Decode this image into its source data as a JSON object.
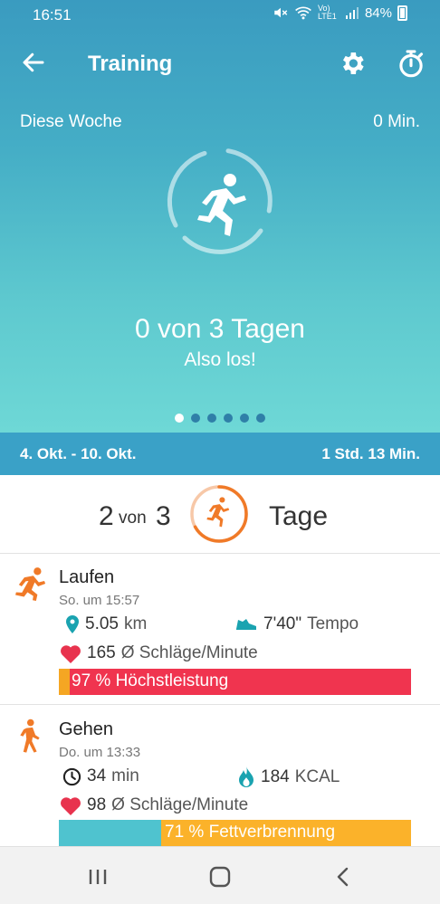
{
  "status_bar": {
    "time": "16:51",
    "network": "Vo) LTE1",
    "battery": "84%"
  },
  "app_bar": {
    "title": "Training"
  },
  "hero": {
    "week_label": "Diese Woche",
    "week_minutes": "0 Min.",
    "days_text": "0 von 3 Tagen",
    "cheer_text": "Also los!",
    "page_count": 6,
    "active_page": 0
  },
  "range": {
    "dates": "4. Okt. - 10. Okt.",
    "total": "1 Std. 13 Min."
  },
  "summary": {
    "done": "2",
    "von": "von",
    "goal": "3",
    "unit": "Tage",
    "progress": 0.67
  },
  "activities": [
    {
      "name": "Laufen",
      "date": "So. um 15:57",
      "icon": "running-icon",
      "stat1_value": "5.05",
      "stat1_unit": "km",
      "stat1_icon": "location-pin-icon",
      "stat2_value": "7'40\"",
      "stat2_unit": "Tempo",
      "stat2_icon": "shoe-icon",
      "heart_value": "165",
      "heart_unit": "Ø Schläge/Minute",
      "bar_label": "97 % Höchstleistung",
      "bar_segments": [
        {
          "color": "#f5a623",
          "fraction": 0.03
        },
        {
          "color": "#f0344f",
          "fraction": 0.97
        }
      ]
    },
    {
      "name": "Gehen",
      "date": "Do. um 13:33",
      "icon": "walking-icon",
      "stat1_value": "34",
      "stat1_unit": "min",
      "stat1_icon": "clock-icon",
      "stat2_value": "184",
      "stat2_unit": "KCAL",
      "stat2_icon": "flame-icon",
      "heart_value": "98",
      "heart_unit": "Ø Schläge/Minute",
      "bar_label": "71 % Fettverbrennung",
      "bar_segments": [
        {
          "color": "#4fc3cf",
          "fraction": 0.29
        },
        {
          "color": "#fbb22a",
          "fraction": 0.71
        }
      ]
    }
  ],
  "colors": {
    "hero_top": "#3a9bc0",
    "hero_bottom": "#6ed8d6",
    "accent_orange": "#f07a28",
    "heart": "#e8334e"
  }
}
